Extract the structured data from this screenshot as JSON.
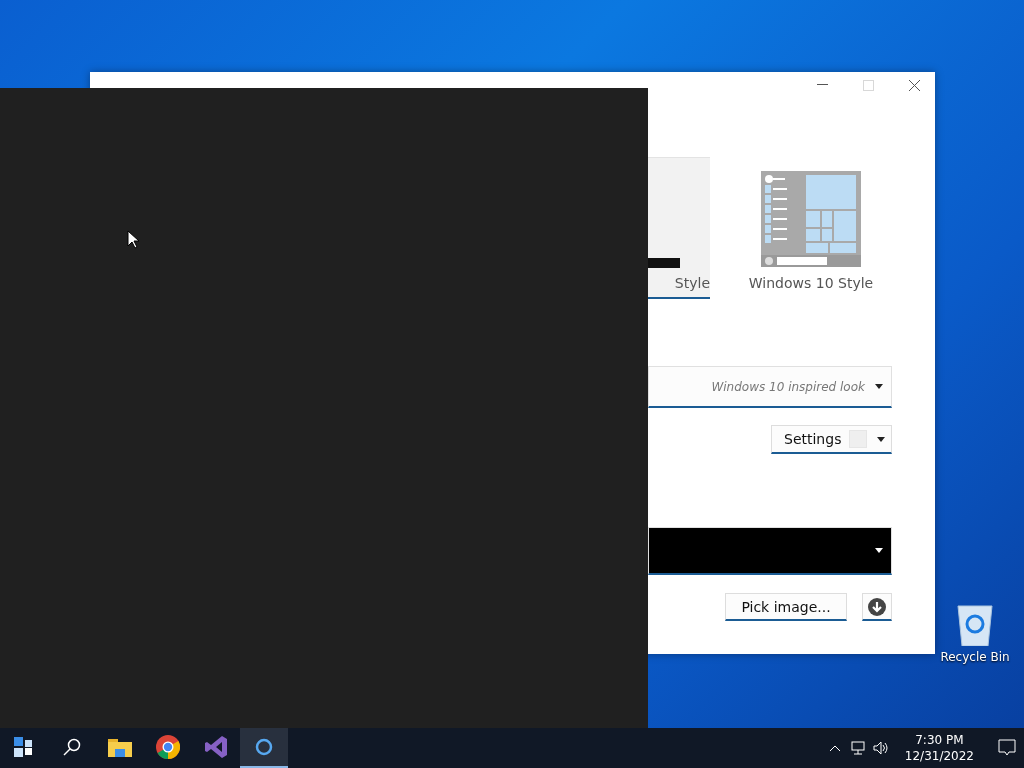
{
  "window": {
    "controls": [
      {
        "kind": "minimize",
        "disabled": false
      },
      {
        "kind": "maximize",
        "disabled": true
      },
      {
        "kind": "close",
        "disabled": false
      }
    ]
  },
  "styles": [
    {
      "label": "Style",
      "selected": true
    },
    {
      "label": "Windows 10 Style",
      "selected": false
    }
  ],
  "skin_dropdown": {
    "value": "Windows 10 inspired look"
  },
  "settings_button": {
    "label": "Settings"
  },
  "pick_image_button": {
    "label": "Pick image..."
  },
  "desktop_icons": [
    {
      "label": "Recycle Bin"
    }
  ],
  "taskbar": {
    "apps": [
      {
        "kind": "start",
        "active": false
      },
      {
        "kind": "search",
        "active": false
      },
      {
        "kind": "explorer",
        "active": false
      },
      {
        "kind": "chrome",
        "active": false
      },
      {
        "kind": "studio",
        "active": false
      },
      {
        "kind": "ring",
        "active": true
      }
    ],
    "time": "7:30 PM",
    "date": "12/31/2022"
  }
}
